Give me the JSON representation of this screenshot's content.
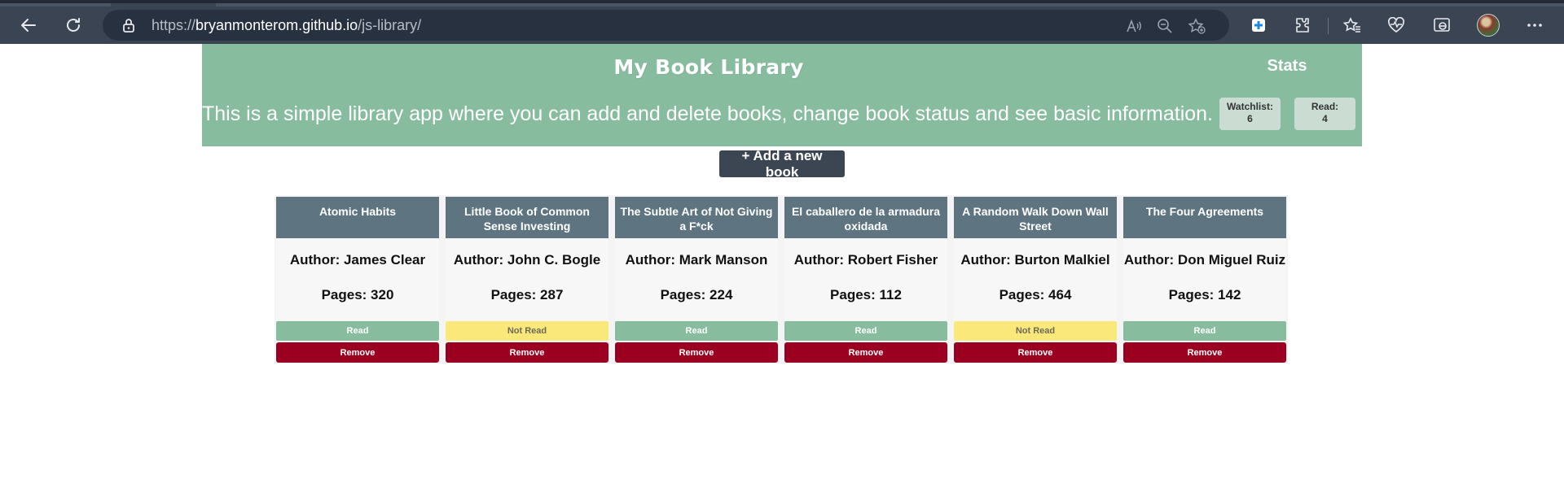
{
  "browser": {
    "url_prefix": "https://",
    "url_host": "bryanmonterom.github.io",
    "url_path": "/js-library/",
    "icons": {
      "back": "back-arrow-icon",
      "reload": "reload-icon",
      "lock": "lock-icon",
      "read_aloud": "read-aloud-icon",
      "zoom": "zoom-out-icon",
      "add_favorite": "add-favorite-icon",
      "extension": "extension-icon",
      "extensions": "extensions-icon",
      "favorites": "favorites-icon",
      "health": "browser-essentials-icon",
      "ie_mode": "ie-mode-icon",
      "profile": "profile-avatar",
      "more": "more-icon"
    }
  },
  "header": {
    "title": "My Book Library",
    "description": "This is a simple library app where you can add and delete books, change book status and see basic information.",
    "stats_title": "Stats",
    "watchlist_label": "Watchlist:",
    "watchlist_count": "6",
    "read_label": "Read:",
    "read_count": "4"
  },
  "add_button_label": "+ Add a new book",
  "books": [
    {
      "title": "Atomic Habits",
      "author": "Author: James Clear",
      "pages": "Pages: 320",
      "status": "Read",
      "remove": "Remove"
    },
    {
      "title": "Little Book of Common Sense Investing",
      "author": "Author: John C. Bogle",
      "pages": "Pages: 287",
      "status": "Not Read",
      "remove": "Remove"
    },
    {
      "title": "The Subtle Art of Not Giving a F*ck",
      "author": "Author: Mark Manson",
      "pages": "Pages: 224",
      "status": "Read",
      "remove": "Remove"
    },
    {
      "title": "El caballero de la armadura oxidada",
      "author": "Author: Robert Fisher",
      "pages": "Pages: 112",
      "status": "Read",
      "remove": "Remove"
    },
    {
      "title": "A Random Walk Down Wall Street",
      "author": "Author: Burton Malkiel",
      "pages": "Pages: 464",
      "status": "Not Read",
      "remove": "Remove"
    },
    {
      "title": "The Four Agreements",
      "author": "Author: Don Miguel Ruiz",
      "pages": "Pages: 142",
      "status": "Read",
      "remove": "Remove"
    }
  ],
  "colors": {
    "header_bg": "#87bc9e",
    "card_title_bg": "#5e7581",
    "read": "#87bc9e",
    "not_read": "#fbe87a",
    "remove": "#9b0020",
    "add_button": "#3b4652"
  }
}
